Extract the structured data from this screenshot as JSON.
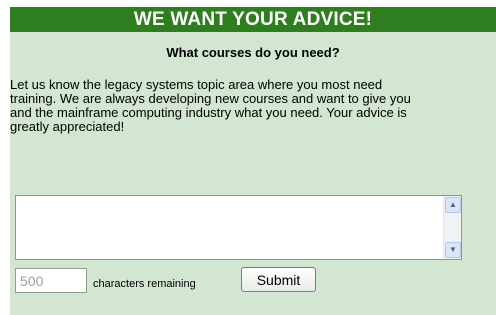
{
  "header": {
    "title": "WE WANT YOUR ADVICE!"
  },
  "form": {
    "subheading": "What courses do you need?",
    "description_lines": [
      "Let us know the legacy systems topic area where you most need",
      "training. We are always developing new courses and want to give you",
      "and the mainframe computing industry what you need. Your advice is",
      "greatly appreciated!"
    ],
    "textarea_value": "",
    "char_count": "500",
    "char_count_label": "characters remaining",
    "submit_label": "Submit"
  },
  "colors": {
    "header_bg": "#2e7d1f",
    "panel_bg": "#d3e6d2"
  },
  "icons": {
    "scroll_up": "scroll-up-arrow-icon",
    "scroll_down": "scroll-down-arrow-icon"
  }
}
